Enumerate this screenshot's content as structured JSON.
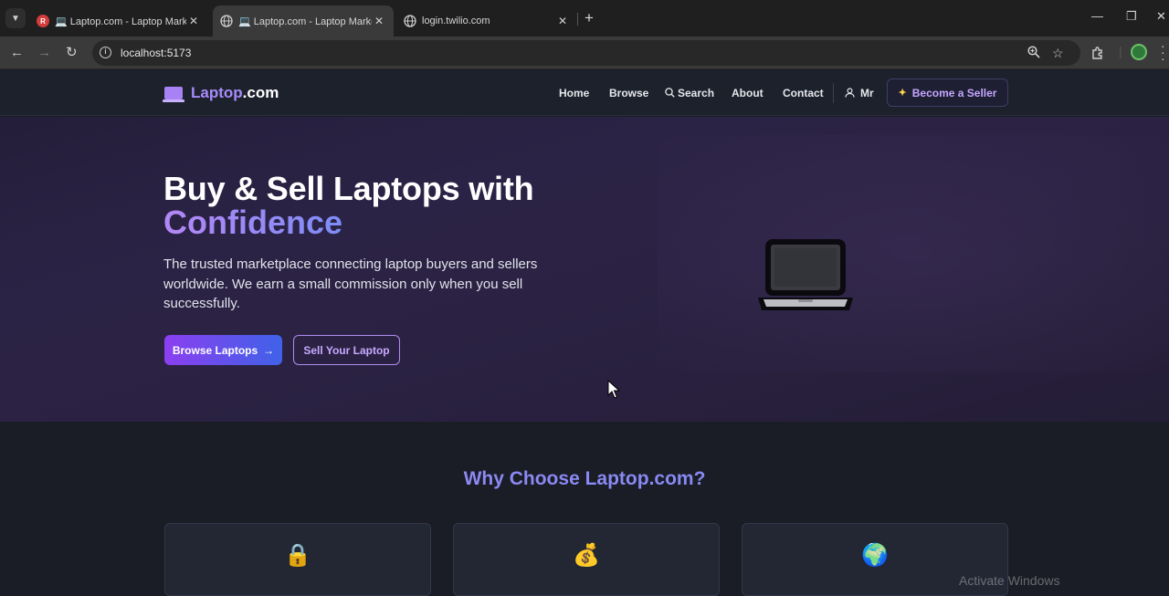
{
  "browser": {
    "tabs": [
      {
        "title": "💻 Laptop.com - Laptop Marke",
        "favicon": "recorder-icon",
        "active": false
      },
      {
        "title": "💻 Laptop.com - Laptop Marke",
        "favicon": "globe-icon",
        "active": true
      },
      {
        "title": "login.twilio.com",
        "favicon": "globe-icon",
        "active": false
      }
    ],
    "url": "localhost:5173"
  },
  "header": {
    "logo_part1": "Laptop",
    "logo_part2": ".com",
    "nav": {
      "home": "Home",
      "browse": "Browse",
      "search": "Search",
      "about": "About",
      "contact": "Contact",
      "user": "Mr"
    },
    "seller_button": "Become a Seller"
  },
  "hero": {
    "title_line1": "Buy & Sell Laptops with",
    "title_line2": "Confidence",
    "subtitle": "The trusted marketplace connecting laptop buyers and sellers worldwide. We earn a small commission only when you sell successfully.",
    "primary_button": "Browse Laptops",
    "primary_button_arrow": "→",
    "secondary_button": "Sell Your Laptop",
    "illustration": "laptop-icon"
  },
  "features": {
    "title": "Why Choose Laptop.com?",
    "cards": [
      {
        "icon": "🔒",
        "icon_name": "lock-icon"
      },
      {
        "icon": "💰",
        "icon_name": "money-bag-icon"
      },
      {
        "icon": "🌍",
        "icon_name": "globe-icon"
      }
    ]
  },
  "os": {
    "watermark": "Activate Windows"
  },
  "colors": {
    "accent_purple": "#8b3ff0",
    "accent_blue": "#3f62e8",
    "logo_purple": "#a78bfa",
    "page_bg": "#1a1d26"
  }
}
